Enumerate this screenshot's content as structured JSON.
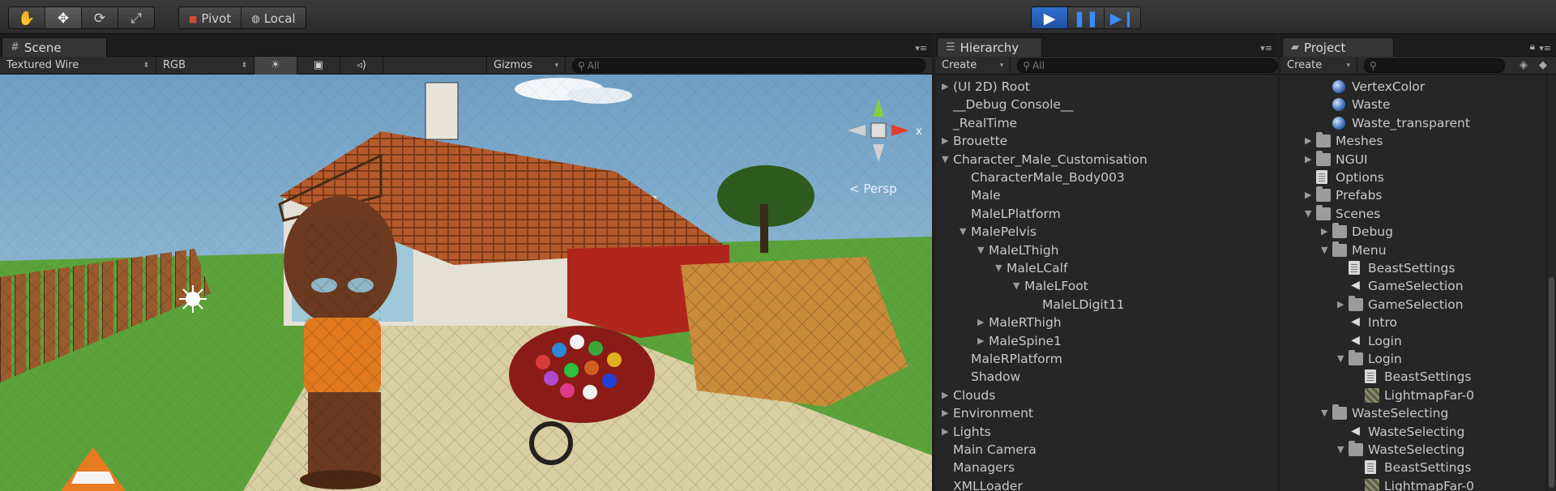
{
  "toolbar": {
    "tools": [
      "hand-tool",
      "move-tool",
      "rotate-tool",
      "scale-tool"
    ],
    "pivot_label": "Pivot",
    "local_label": "Local",
    "play_icons": [
      "play-icon",
      "pause-icon",
      "step-icon"
    ]
  },
  "scene": {
    "tab_label": "Scene",
    "shading_mode": "Textured Wire",
    "color_mode": "RGB",
    "gizmos_label": "Gizmos",
    "search_placeholder": "All",
    "persp_label": "Persp",
    "gizmo_axis": "x"
  },
  "hierarchy": {
    "tab_label": "Hierarchy",
    "create_label": "Create",
    "search_placeholder": "All",
    "items": [
      {
        "label": "(UI 2D) Root",
        "depth": 0,
        "arrow": "right"
      },
      {
        "label": "__Debug Console__",
        "depth": 0,
        "arrow": ""
      },
      {
        "label": "_RealTime",
        "depth": 0,
        "arrow": ""
      },
      {
        "label": "Brouette",
        "depth": 0,
        "arrow": "right"
      },
      {
        "label": "Character_Male_Customisation",
        "depth": 0,
        "arrow": "down"
      },
      {
        "label": "CharacterMale_Body003",
        "depth": 1,
        "arrow": ""
      },
      {
        "label": "Male",
        "depth": 1,
        "arrow": ""
      },
      {
        "label": "MaleLPlatform",
        "depth": 1,
        "arrow": ""
      },
      {
        "label": "MalePelvis",
        "depth": 1,
        "arrow": "down"
      },
      {
        "label": "MaleLThigh",
        "depth": 2,
        "arrow": "down"
      },
      {
        "label": "MaleLCalf",
        "depth": 3,
        "arrow": "down"
      },
      {
        "label": "MaleLFoot",
        "depth": 4,
        "arrow": "down"
      },
      {
        "label": "MaleLDigit11",
        "depth": 5,
        "arrow": ""
      },
      {
        "label": "MaleRThigh",
        "depth": 2,
        "arrow": "right"
      },
      {
        "label": "MaleSpine1",
        "depth": 2,
        "arrow": "right"
      },
      {
        "label": "MaleRPlatform",
        "depth": 1,
        "arrow": ""
      },
      {
        "label": "Shadow",
        "depth": 1,
        "arrow": ""
      },
      {
        "label": "Clouds",
        "depth": 0,
        "arrow": "right"
      },
      {
        "label": "Environment",
        "depth": 0,
        "arrow": "right"
      },
      {
        "label": "Lights",
        "depth": 0,
        "arrow": "right"
      },
      {
        "label": "Main Camera",
        "depth": 0,
        "arrow": ""
      },
      {
        "label": "Managers",
        "depth": 0,
        "arrow": ""
      },
      {
        "label": "XMLLoader",
        "depth": 0,
        "arrow": ""
      }
    ]
  },
  "project": {
    "tab_label": "Project",
    "create_label": "Create",
    "items": [
      {
        "label": "VertexColor",
        "depth": 1,
        "arrow": "",
        "icon": "material"
      },
      {
        "label": "Waste",
        "depth": 1,
        "arrow": "",
        "icon": "material"
      },
      {
        "label": "Waste_transparent",
        "depth": 1,
        "arrow": "",
        "icon": "material"
      },
      {
        "label": "Meshes",
        "depth": 0,
        "arrow": "right",
        "icon": "folder"
      },
      {
        "label": "NGUI",
        "depth": 0,
        "arrow": "right",
        "icon": "folder"
      },
      {
        "label": "Options",
        "depth": 0,
        "arrow": "",
        "icon": "script"
      },
      {
        "label": "Prefabs",
        "depth": 0,
        "arrow": "right",
        "icon": "folder"
      },
      {
        "label": "Scenes",
        "depth": 0,
        "arrow": "down",
        "icon": "folder"
      },
      {
        "label": "Debug",
        "depth": 1,
        "arrow": "right",
        "icon": "folder"
      },
      {
        "label": "Menu",
        "depth": 1,
        "arrow": "down",
        "icon": "folder"
      },
      {
        "label": "BeastSettings",
        "depth": 2,
        "arrow": "",
        "icon": "script"
      },
      {
        "label": "GameSelection",
        "depth": 2,
        "arrow": "",
        "icon": "scene"
      },
      {
        "label": "GameSelection",
        "depth": 2,
        "arrow": "right",
        "icon": "folder"
      },
      {
        "label": "Intro",
        "depth": 2,
        "arrow": "",
        "icon": "scene"
      },
      {
        "label": "Login",
        "depth": 2,
        "arrow": "",
        "icon": "scene"
      },
      {
        "label": "Login",
        "depth": 2,
        "arrow": "down",
        "icon": "folder"
      },
      {
        "label": "BeastSettings",
        "depth": 3,
        "arrow": "",
        "icon": "script"
      },
      {
        "label": "LightmapFar-0",
        "depth": 3,
        "arrow": "",
        "icon": "texture"
      },
      {
        "label": "WasteSelecting",
        "depth": 1,
        "arrow": "down",
        "icon": "folder"
      },
      {
        "label": "WasteSelecting",
        "depth": 2,
        "arrow": "",
        "icon": "scene"
      },
      {
        "label": "WasteSelecting",
        "depth": 2,
        "arrow": "down",
        "icon": "folder"
      },
      {
        "label": "BeastSettings",
        "depth": 3,
        "arrow": "",
        "icon": "script"
      },
      {
        "label": "LightmapFar-0",
        "depth": 3,
        "arrow": "",
        "icon": "texture"
      }
    ]
  }
}
